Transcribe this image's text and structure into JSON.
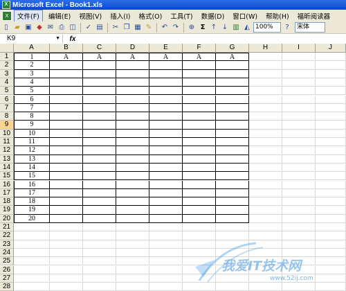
{
  "window": {
    "title": "Microsoft Excel - Book1.xls"
  },
  "menu": {
    "items": [
      "文件(F)",
      "编辑(E)",
      "视图(V)",
      "插入(I)",
      "格式(O)",
      "工具(T)",
      "数据(D)",
      "窗口(W)",
      "帮助(H)",
      "福昕阅读器"
    ]
  },
  "toolbar": {
    "icons": [
      "new-doc-icon",
      "open-icon",
      "save-icon",
      "permission-icon",
      "email-icon",
      "print-icon",
      "print-preview-icon",
      "spelling-icon",
      "research-icon",
      "cut-icon",
      "copy-icon",
      "paste-icon",
      "format-painter-icon",
      "undo-icon",
      "redo-icon",
      "hyperlink-icon",
      "autosum-icon",
      "sort-asc-icon",
      "sort-desc-icon",
      "chart-wizard-icon",
      "drawing-icon",
      "help-icon"
    ],
    "autosum_symbol": "Σ",
    "zoom": "100%",
    "font": "宋体"
  },
  "formula_bar": {
    "name_box": "K9",
    "fx": "fx",
    "content": ""
  },
  "sheet": {
    "columns": [
      "A",
      "B",
      "C",
      "D",
      "E",
      "F",
      "G",
      "H",
      "I",
      "J"
    ],
    "row_count": 28,
    "selected_row": 9,
    "header_row_values": [
      "A",
      "A",
      "A",
      "A",
      "A",
      "A"
    ],
    "col_a_values": [
      "1",
      "2",
      "3",
      "4",
      "5",
      "6",
      "7",
      "8",
      "9",
      "10",
      "11",
      "12",
      "13",
      "14",
      "15",
      "16",
      "17",
      "18",
      "19",
      "20"
    ]
  },
  "watermark": {
    "text": "我爱IT技术网",
    "url": "www.52ij.com"
  }
}
